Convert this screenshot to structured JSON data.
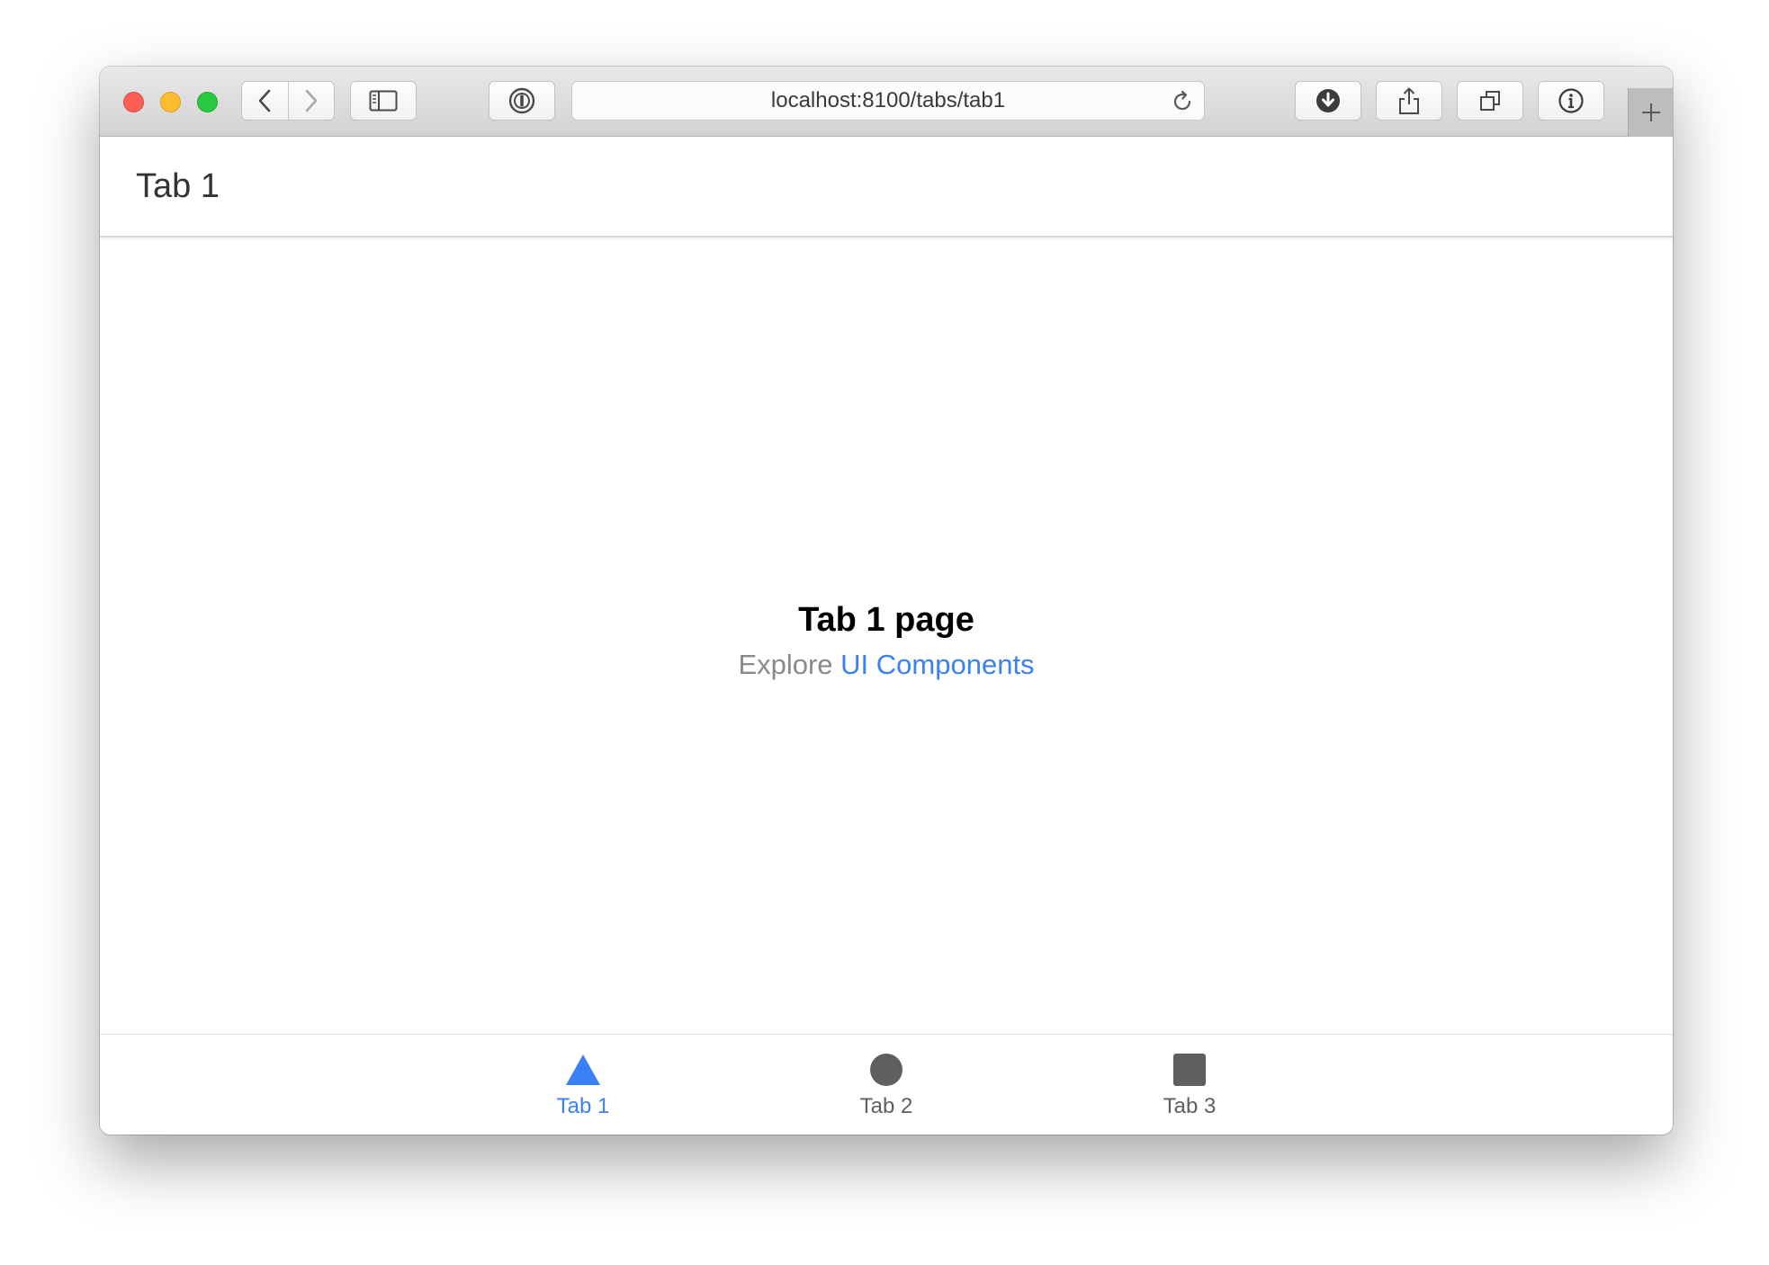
{
  "browser": {
    "url": "localhost:8100/tabs/tab1",
    "new_tab_symbol": "+"
  },
  "header": {
    "title": "Tab 1"
  },
  "content": {
    "page_title": "Tab 1 page",
    "explore_prefix": "Explore",
    "explore_link": "UI Components"
  },
  "tabs": [
    {
      "label": "Tab 1",
      "icon": "triangle-icon",
      "active": true
    },
    {
      "label": "Tab 2",
      "icon": "ellipse-icon",
      "active": false
    },
    {
      "label": "Tab 3",
      "icon": "square-icon",
      "active": false
    }
  ],
  "colors": {
    "accent": "#3a80f6",
    "inactive": "#5f5f5f"
  }
}
